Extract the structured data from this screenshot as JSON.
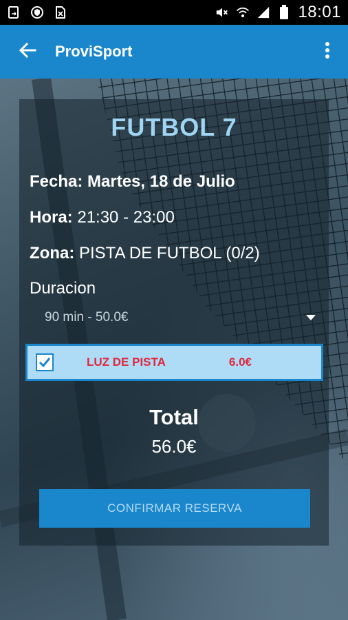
{
  "status_bar": {
    "time": "18:01",
    "left_icons": [
      "screenshot-icon",
      "shield-icon",
      "no-sim-icon"
    ],
    "right_icons": [
      "mute-icon",
      "wifi-icon",
      "signal-icon",
      "battery-icon"
    ]
  },
  "app_bar": {
    "title": "ProviSport",
    "back_icon": "arrow-left-icon",
    "menu_icon": "more-vert-icon",
    "color": "#1a86cc"
  },
  "reservation": {
    "sport": "FUTBOL 7",
    "fecha_label": "Fecha:",
    "fecha_value": "Martes, 18 de Julio",
    "hora_label": "Hora:",
    "hora_value": "21:30 - 23:00",
    "zona_label": "Zona:",
    "zona_value": "PISTA DE FUTBOL (0/2)",
    "duracion_label": "Duracion",
    "duracion_selected": "90 min - 50.0€",
    "extras": [
      {
        "name": "LUZ DE PISTA",
        "price": "6.0€",
        "checked": true
      }
    ],
    "total_label": "Total",
    "total_value": "56.0€",
    "confirm_label": "CONFIRMAR RESERVA"
  },
  "colors": {
    "accent": "#1a86cc",
    "title": "#9fd4f3",
    "extra_text": "#e0263b",
    "extra_bg": "#aedbf5"
  }
}
